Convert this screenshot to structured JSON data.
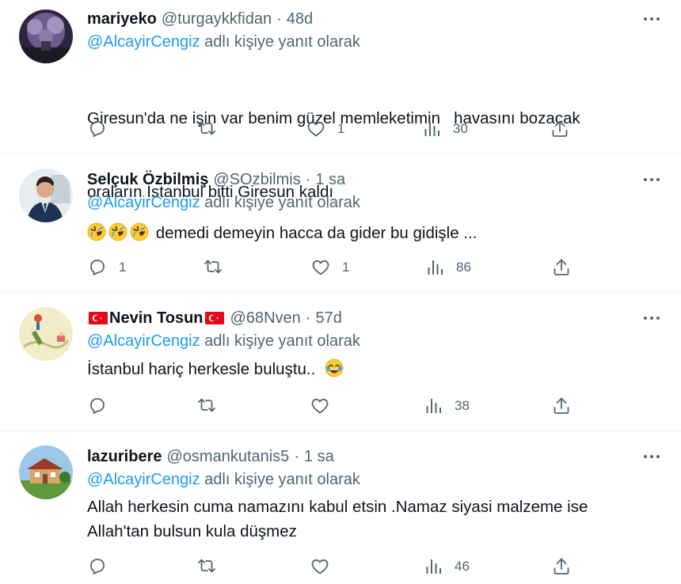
{
  "colors": {
    "link": "#1d9bf0",
    "muted": "#536471",
    "text": "#0f1419",
    "divider": "#eff3f4"
  },
  "icons": {
    "more": "more-horizontal-icon",
    "reply": "reply-icon",
    "retweet": "retweet-icon",
    "like": "heart-icon",
    "views": "views-icon",
    "share": "share-icon"
  },
  "tweets": [
    {
      "name": "mariyeko",
      "handle": "@turgaykkfidan",
      "sep": "·",
      "time": "48d",
      "reply_mention": "@AlcayirCengiz",
      "reply_suffix": " adlı kişiye yanıt olarak",
      "text_line1": "Giresun'da ne işin var benim güzel memleketimin   havasını bozacak",
      "text_line2": "oraların İstanbul bitti Giresun kaldı",
      "replies": "",
      "retweets": "",
      "likes": "1",
      "views": "30"
    },
    {
      "name": "Selçuk Özbilmiş",
      "handle": "@SOzbilmis",
      "sep": "·",
      "time": "1 sa",
      "reply_mention": "@AlcayirCengiz",
      "reply_suffix": " adlı kişiye yanıt olarak",
      "text": "demedi demeyin hacca da gider bu gidişle ...",
      "emoji": "rolling-on-floor-laughing-emoji",
      "replies": "1",
      "retweets": "",
      "likes": "1",
      "views": "86"
    },
    {
      "name": "Nevin Tosun",
      "flag": "turkey-flag",
      "handle": "@68Nven",
      "sep": "·",
      "time": "57d",
      "reply_mention": "@AlcayirCengiz",
      "reply_suffix": " adlı kişiye yanıt olarak",
      "text": "İstanbul hariç herkesle buluştu..",
      "emoji": "face-with-tears-of-joy-emoji",
      "replies": "",
      "retweets": "",
      "likes": "",
      "views": "38"
    },
    {
      "name": "lazuribere",
      "handle": "@osmankutanis5",
      "sep": "·",
      "time": "1 sa",
      "reply_mention": "@AlcayirCengiz",
      "reply_suffix": " adlı kişiye yanıt olarak",
      "text_line1": "Allah herkesin cuma namazını kabul etsin .Namaz siyasi malzeme ise",
      "text_line2": "Allah'tan bulsun kula düşmez",
      "replies": "",
      "retweets": "",
      "likes": "",
      "views": "46"
    }
  ]
}
